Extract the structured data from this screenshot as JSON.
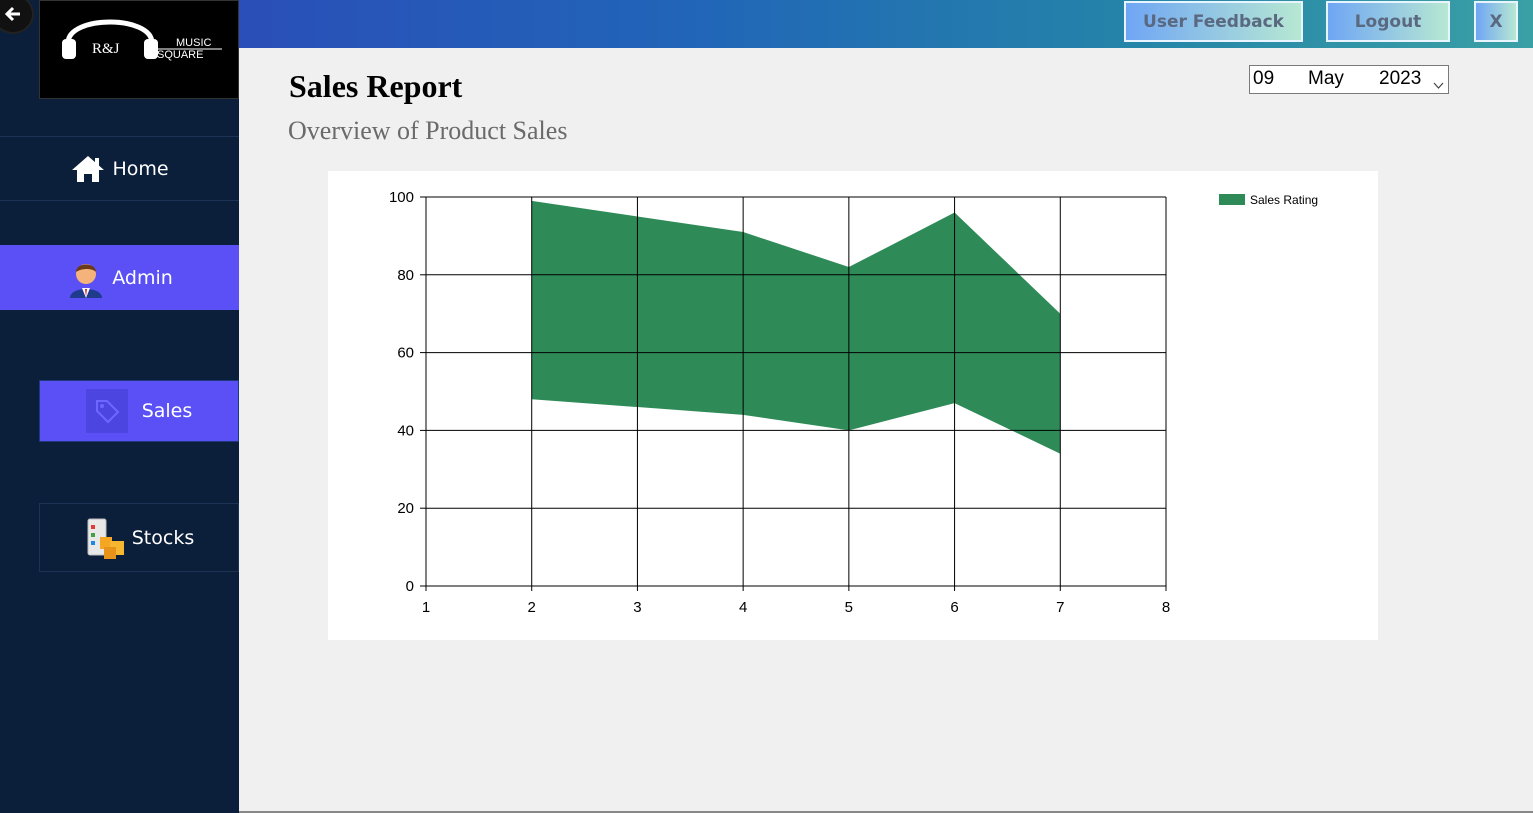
{
  "logo": {
    "mark": "R&J",
    "line1": "MUSIC",
    "line2": "SQUARE"
  },
  "sidebar": {
    "items": [
      {
        "label": "Home",
        "icon": "home-icon"
      },
      {
        "label": "Admin",
        "icon": "admin-avatar-icon"
      },
      {
        "label": "Sales",
        "icon": "tag-icon"
      },
      {
        "label": "Stocks",
        "icon": "stocks-icon"
      }
    ]
  },
  "topbar": {
    "feedback_label": "User Feedback",
    "logout_label": "Logout",
    "close_label": "X"
  },
  "header": {
    "title": "Sales Report",
    "subtitle": "Overview of Product Sales"
  },
  "date_picker": {
    "day": "09",
    "month": "May",
    "year": "2023"
  },
  "colors": {
    "sidebar_bg": "#0b1e3a",
    "accent": "#5a50f5",
    "series": "#2e8b57"
  },
  "chart_data": {
    "type": "area",
    "x": [
      2,
      3,
      4,
      5,
      6,
      7
    ],
    "upper": [
      99,
      95,
      91,
      82,
      96,
      70
    ],
    "lower": [
      48,
      46,
      44,
      40,
      47,
      34
    ],
    "xlim": [
      1,
      8
    ],
    "ylim": [
      0,
      100
    ],
    "xticks": [
      1,
      2,
      3,
      4,
      5,
      6,
      7,
      8
    ],
    "yticks": [
      0,
      20,
      40,
      60,
      80,
      100
    ],
    "series": [
      {
        "name": "Sales Rating"
      }
    ],
    "grid": true,
    "legend": "top-right"
  }
}
